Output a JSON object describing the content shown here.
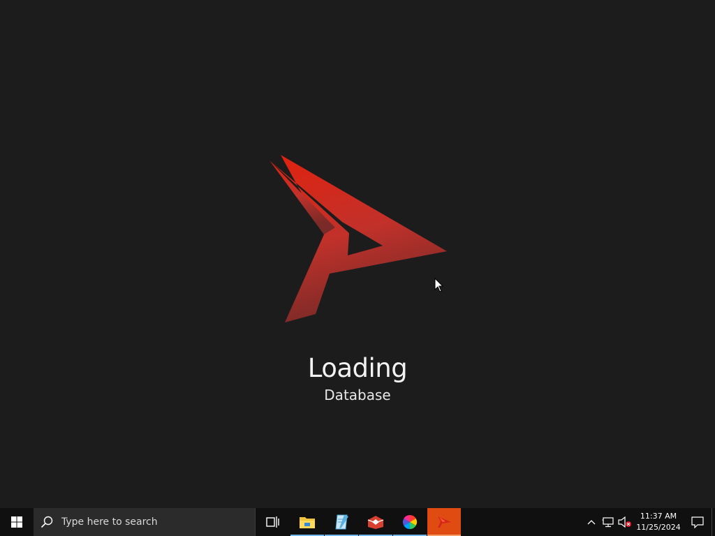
{
  "splash": {
    "status_title": "Loading",
    "status_detail": "Database",
    "logo_icon": "arrowhead-logo-icon",
    "accent_color": "#d4261a"
  },
  "taskbar": {
    "start_icon": "windows-start-icon",
    "search": {
      "placeholder": "Type here to search",
      "icon": "search-icon"
    },
    "pinned": [
      {
        "icon": "task-view-icon"
      },
      {
        "icon": "file-explorer-icon"
      },
      {
        "icon": "notepad-icon"
      },
      {
        "icon": "toolbox-app-icon"
      },
      {
        "icon": "color-wheel-app-icon"
      },
      {
        "icon": "arrowhead-app-icon"
      }
    ],
    "tray": {
      "chevron_icon": "chevron-up-icon",
      "network_icon": "network-icon",
      "volume_icon": "volume-muted-icon",
      "time": "11:37 AM",
      "date": "11/25/2024",
      "notification_icon": "notification-icon"
    }
  }
}
